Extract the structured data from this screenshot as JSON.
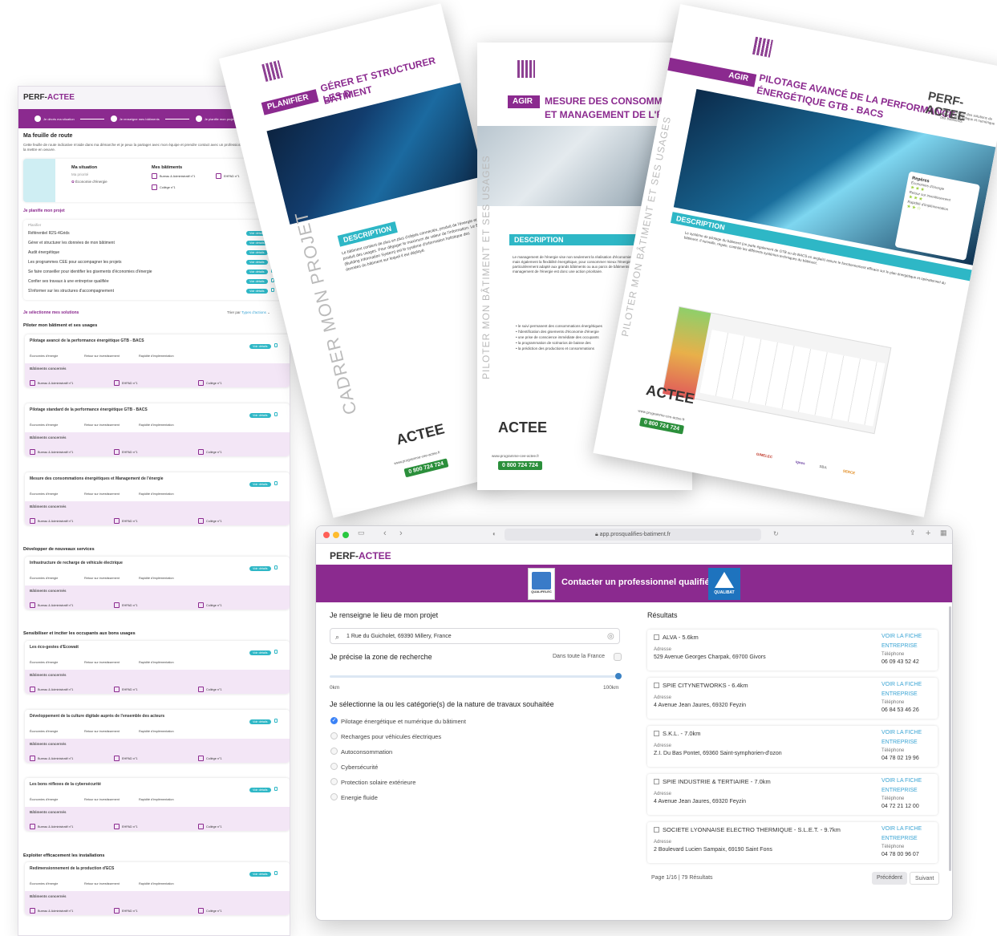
{
  "roadmap": {
    "brand_a": "PERF-",
    "brand_b": "ACTEE",
    "steps": [
      "Je décris ma situation",
      "Je renseigne mes bâtiments",
      "Je planifie mon projet"
    ],
    "title": "Ma feuille de route",
    "intro": "Cette feuille de route indicative m'aide dans ma démarche et je peux la partager avec mon équipe et prendre contact avec un professionnel qui pourra la préciser et la mettre en oeuvre.",
    "situation_title": "Ma situation",
    "situation_sub": "Ma priorité",
    "situation_value": "Économie d'énergie",
    "buildings_title": "Mes bâtiments",
    "b_bureau": "Bureau & Administratif n°1",
    "b_ehpad": "EHPAD n°1",
    "b_college": "Collège n°1",
    "plan_link": "Je planifie mon projet",
    "plan_label": "Planifier",
    "plan_items": [
      "Référentiel R2S-4Grids",
      "Gérer et structurer les données de mon bâtiment",
      "Audit énergétique",
      "Les programmes CEE pour accompagner les projets",
      "Se faire conseiller pour identifier les gisements d'économies d'énergie",
      "Confier ses travaux à une entreprise qualifiée",
      "S'informer sur les structures d'accompagnement"
    ],
    "details_label": "Voir détails",
    "select_link": "Je sélectionne mes solutions",
    "sort_label": "Trier par",
    "sort_value": "Types d'actions",
    "crit_energy": "Économies d'énergie",
    "crit_roi": "Retour sur investissement",
    "crit_speed": "Rapidité d'implémentation",
    "concerned": "Bâtiments concernés",
    "section1": "Piloter mon bâtiment et ses usages",
    "section2": "Développer de nouveaux services",
    "section3": "Sensibiliser et inciter les occupants aux bons usages",
    "section4": "Exploiter efficacement les installations",
    "cards": [
      {
        "title": "Pilotage avancé de la performance énergétique GTB - BACS",
        "s": [
          "★★★",
          "★★★",
          "★★☆"
        ],
        "ehpad": true
      },
      {
        "title": "Pilotage standard de la performance énergétique GTB - BACS",
        "s": [
          "★★☆",
          "★★☆",
          "★★☆"
        ],
        "ehpad": true
      },
      {
        "title": "Mesure des consommations énergétiques et Management de l'énergie",
        "s": [
          "★★☆",
          "★★☆",
          "★★☆"
        ],
        "ehpad": true
      },
      {
        "title": "Infrastructure de recharge de véhicule électrique",
        "s": [
          "★☆☆",
          "★★☆",
          "★★☆"
        ],
        "ehpad": true
      },
      {
        "title": "Les éco-gestes d'Ecowatt",
        "s": [
          "★☆☆",
          "★★★",
          "★★★"
        ],
        "ehpad": true
      },
      {
        "title": "Développement de la culture digitale auprès de l'ensemble des acteurs",
        "s": [
          "★☆☆",
          "☆☆☆",
          "★★☆"
        ],
        "ehpad": true
      },
      {
        "title": "Les bons réflexes de la cybersécurité",
        "s": [
          "☆☆☆",
          "★★★",
          "★★☆"
        ],
        "ehpad": true
      },
      {
        "title": "Redimensionnement de la production d'ECS",
        "s": [
          "★★☆",
          "★★☆",
          "★★☆"
        ],
        "ehpad": true
      }
    ]
  },
  "brochure1": {
    "tag": "PLANIFIER",
    "title_l1": "GÉRER ET STRUCTURER LES D",
    "title_l2": "BÂTIMENT",
    "side": "CADRER MON PROJET",
    "desc": "DESCRIPTION",
    "body": "Le bâtiment contient de plus en plus d'objets connectés, produit de l'énergie et produit des usages. Pour dégager le maximum de valeur de l'information. Le BIS (Building Information System) est le système d'information holistique des données du bâtiment sur lequel il est déployé.",
    "site": "www.programme-cee-actee.fr",
    "phone": "0 800 724 724",
    "actee": "ACTEE"
  },
  "brochure2": {
    "corner": "F-ACTEE",
    "tag": "AGIR",
    "title_l1": "MESURE DES CONSOMMA",
    "title_l2": "ET MANAGEMENT DE L'ÉN",
    "side": "PILOTER MON BÂTIMENT ET SES USAGES",
    "desc": "DESCRIPTION",
    "body": "Le management de l'énergie vise non seulement la réalisation d'économies d'énergie mais également la flexibilité énergétique, pour consommer mieux l'énergie. Il est particulièrement adapté aux grands bâtiments ou aux parcs de bâtiments. Le management de l'énergie est donc une action prioritaire.",
    "bullets": [
      "le suivi permanent des consommations énergétiques",
      "l'identification des gisements d'économie d'énergie",
      "une prise de conscience immédiate des occupants",
      "la programmation de scénarios de baisse des",
      "la prédiction des productions et consommations"
    ],
    "site": "www.programme-cee-actee.fr",
    "phone": "0 800 724 724",
    "actee": "ACTEE"
  },
  "brochure3": {
    "tag": "AGIR",
    "title_l1": "PILOTAGE AVANCÉ DE LA PERFORMANCE",
    "title_l2": "ÉNERGÉTIQUE GTB - BACS",
    "brand": "PERF-ACTEE",
    "brand_sub": "Guide interactif des solutions de pilotage énergétique et numérique des bâtiments",
    "side": "PILOTER MON BÂTIMENT ET SES USAGES",
    "desc": "DESCRIPTION",
    "reperes": "Repères",
    "r1": "Économies d'énergie",
    "r2": "Retour sur investissement",
    "r3": "Rapidité d'implémentation",
    "body": "Le système de pilotage du bâtiment (on parle également de GTB ou de BACS en anglais) assure le fonctionnement efficace sur le plan énergétique et opérationnel du bâtiment. Il surveille, régule, contrôle les différents systèmes techniques du bâtiment.",
    "site": "www.programme-cee-actee.fr",
    "phone": "0 800 724 724",
    "actee": "ACTEE",
    "partners": [
      "GIMELEC",
      "ignes",
      "SBA",
      "SERCE"
    ]
  },
  "browser": {
    "url": "app.prosqualifies-batiment.fr",
    "brand_a": "PERF-",
    "brand_b": "ACTEE",
    "banner": "Contacter un professionnel qualifié",
    "qualifelec": "QUALIFELEC",
    "qualibat": "QUALIBAT",
    "place_label": "Je renseigne le lieu de mon projet",
    "address": "1 Rue du Guicholet, 69390 Millery, France",
    "zone_label": "Je précise la zone de recherche",
    "zone_toggle": "Dans toute la France",
    "km_min": "0km",
    "km_max": "100km",
    "cat_label": "Je sélectionne la ou les catégorie(s) de la nature de travaux souhaitée",
    "categories": [
      {
        "label": "Pilotage énergétique et numérique du bâtiment",
        "checked": true
      },
      {
        "label": "Recharges pour véhicules électriques",
        "checked": false
      },
      {
        "label": "Autoconsommation",
        "checked": false
      },
      {
        "label": "Cybersécurité",
        "checked": false
      },
      {
        "label": "Protection solaire extérieure",
        "checked": false
      },
      {
        "label": "Energie fluide",
        "checked": false
      }
    ],
    "results_label": "Résultats",
    "address_label": "Adresse",
    "phone_label": "Téléphone",
    "view_label": "VOIR LA FICHE ENTREPRISE",
    "results": [
      {
        "name": "ALVA - 5.6km",
        "address": "529 Avenue Georges Charpak, 69700 Givors",
        "phone": "06 09 43 52 42"
      },
      {
        "name": "SPIE CITYNETWORKS - 6.4km",
        "address": "4 Avenue Jean Jaures, 69320 Feyzin",
        "phone": "06 84 53 46 26"
      },
      {
        "name": "S.K.L. - 7.0km",
        "address": "Z.I. Du Bas Pontet, 69360 Saint-symphorien-d'ozon",
        "phone": "04 78 02 19 96"
      },
      {
        "name": "SPIE INDUSTRIE & TERTIAIRE - 7.0km",
        "address": "4 Avenue Jean Jaures, 69320 Feyzin",
        "phone": "04 72 21 12 00"
      },
      {
        "name": "SOCIETE LYONNAISE ELECTRO THERMIQUE - S.L.E.T. - 9.7km",
        "address": "2 Boulevard Lucien Sampaix, 69190 Saint Fons",
        "phone": "04 78 00 96 07"
      }
    ],
    "pagination": "Page 1/16 | 79 Résultats",
    "prev": "Précédent",
    "next": "Suivant"
  },
  "colors": {
    "primary": "#8b2a8f",
    "accent": "#2eb7c6",
    "stars": "#9dcf3e",
    "link": "#3aa4d4"
  }
}
